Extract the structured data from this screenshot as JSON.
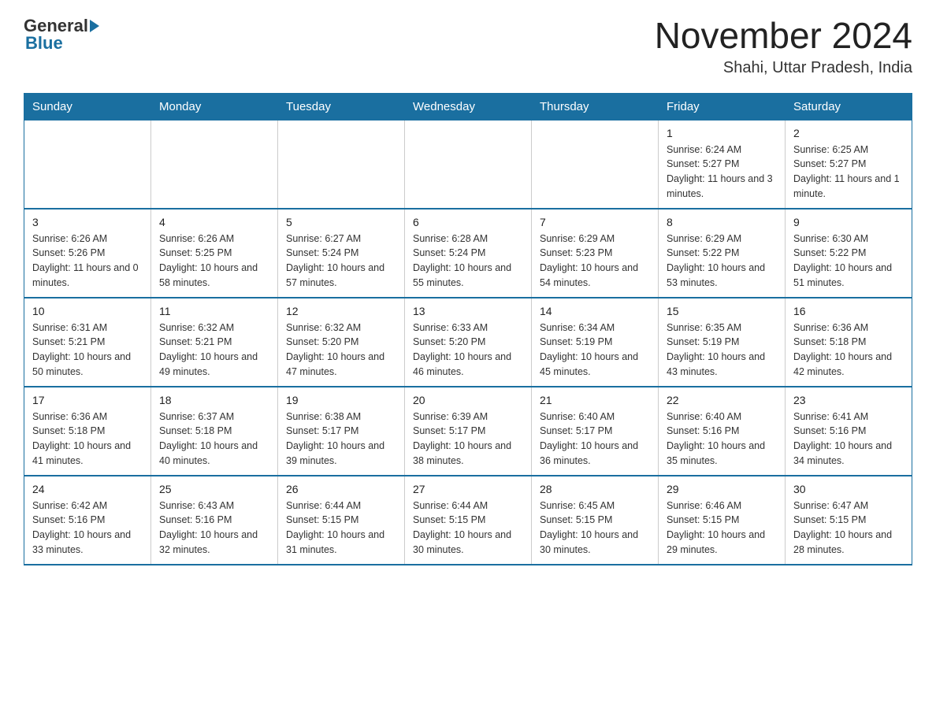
{
  "header": {
    "logo_general": "General",
    "logo_blue": "Blue",
    "month_year": "November 2024",
    "location": "Shahi, Uttar Pradesh, India"
  },
  "days_of_week": [
    "Sunday",
    "Monday",
    "Tuesday",
    "Wednesday",
    "Thursday",
    "Friday",
    "Saturday"
  ],
  "weeks": [
    [
      {
        "day": "",
        "info": ""
      },
      {
        "day": "",
        "info": ""
      },
      {
        "day": "",
        "info": ""
      },
      {
        "day": "",
        "info": ""
      },
      {
        "day": "",
        "info": ""
      },
      {
        "day": "1",
        "info": "Sunrise: 6:24 AM\nSunset: 5:27 PM\nDaylight: 11 hours and 3 minutes."
      },
      {
        "day": "2",
        "info": "Sunrise: 6:25 AM\nSunset: 5:27 PM\nDaylight: 11 hours and 1 minute."
      }
    ],
    [
      {
        "day": "3",
        "info": "Sunrise: 6:26 AM\nSunset: 5:26 PM\nDaylight: 11 hours and 0 minutes."
      },
      {
        "day": "4",
        "info": "Sunrise: 6:26 AM\nSunset: 5:25 PM\nDaylight: 10 hours and 58 minutes."
      },
      {
        "day": "5",
        "info": "Sunrise: 6:27 AM\nSunset: 5:24 PM\nDaylight: 10 hours and 57 minutes."
      },
      {
        "day": "6",
        "info": "Sunrise: 6:28 AM\nSunset: 5:24 PM\nDaylight: 10 hours and 55 minutes."
      },
      {
        "day": "7",
        "info": "Sunrise: 6:29 AM\nSunset: 5:23 PM\nDaylight: 10 hours and 54 minutes."
      },
      {
        "day": "8",
        "info": "Sunrise: 6:29 AM\nSunset: 5:22 PM\nDaylight: 10 hours and 53 minutes."
      },
      {
        "day": "9",
        "info": "Sunrise: 6:30 AM\nSunset: 5:22 PM\nDaylight: 10 hours and 51 minutes."
      }
    ],
    [
      {
        "day": "10",
        "info": "Sunrise: 6:31 AM\nSunset: 5:21 PM\nDaylight: 10 hours and 50 minutes."
      },
      {
        "day": "11",
        "info": "Sunrise: 6:32 AM\nSunset: 5:21 PM\nDaylight: 10 hours and 49 minutes."
      },
      {
        "day": "12",
        "info": "Sunrise: 6:32 AM\nSunset: 5:20 PM\nDaylight: 10 hours and 47 minutes."
      },
      {
        "day": "13",
        "info": "Sunrise: 6:33 AM\nSunset: 5:20 PM\nDaylight: 10 hours and 46 minutes."
      },
      {
        "day": "14",
        "info": "Sunrise: 6:34 AM\nSunset: 5:19 PM\nDaylight: 10 hours and 45 minutes."
      },
      {
        "day": "15",
        "info": "Sunrise: 6:35 AM\nSunset: 5:19 PM\nDaylight: 10 hours and 43 minutes."
      },
      {
        "day": "16",
        "info": "Sunrise: 6:36 AM\nSunset: 5:18 PM\nDaylight: 10 hours and 42 minutes."
      }
    ],
    [
      {
        "day": "17",
        "info": "Sunrise: 6:36 AM\nSunset: 5:18 PM\nDaylight: 10 hours and 41 minutes."
      },
      {
        "day": "18",
        "info": "Sunrise: 6:37 AM\nSunset: 5:18 PM\nDaylight: 10 hours and 40 minutes."
      },
      {
        "day": "19",
        "info": "Sunrise: 6:38 AM\nSunset: 5:17 PM\nDaylight: 10 hours and 39 minutes."
      },
      {
        "day": "20",
        "info": "Sunrise: 6:39 AM\nSunset: 5:17 PM\nDaylight: 10 hours and 38 minutes."
      },
      {
        "day": "21",
        "info": "Sunrise: 6:40 AM\nSunset: 5:17 PM\nDaylight: 10 hours and 36 minutes."
      },
      {
        "day": "22",
        "info": "Sunrise: 6:40 AM\nSunset: 5:16 PM\nDaylight: 10 hours and 35 minutes."
      },
      {
        "day": "23",
        "info": "Sunrise: 6:41 AM\nSunset: 5:16 PM\nDaylight: 10 hours and 34 minutes."
      }
    ],
    [
      {
        "day": "24",
        "info": "Sunrise: 6:42 AM\nSunset: 5:16 PM\nDaylight: 10 hours and 33 minutes."
      },
      {
        "day": "25",
        "info": "Sunrise: 6:43 AM\nSunset: 5:16 PM\nDaylight: 10 hours and 32 minutes."
      },
      {
        "day": "26",
        "info": "Sunrise: 6:44 AM\nSunset: 5:15 PM\nDaylight: 10 hours and 31 minutes."
      },
      {
        "day": "27",
        "info": "Sunrise: 6:44 AM\nSunset: 5:15 PM\nDaylight: 10 hours and 30 minutes."
      },
      {
        "day": "28",
        "info": "Sunrise: 6:45 AM\nSunset: 5:15 PM\nDaylight: 10 hours and 30 minutes."
      },
      {
        "day": "29",
        "info": "Sunrise: 6:46 AM\nSunset: 5:15 PM\nDaylight: 10 hours and 29 minutes."
      },
      {
        "day": "30",
        "info": "Sunrise: 6:47 AM\nSunset: 5:15 PM\nDaylight: 10 hours and 28 minutes."
      }
    ]
  ]
}
